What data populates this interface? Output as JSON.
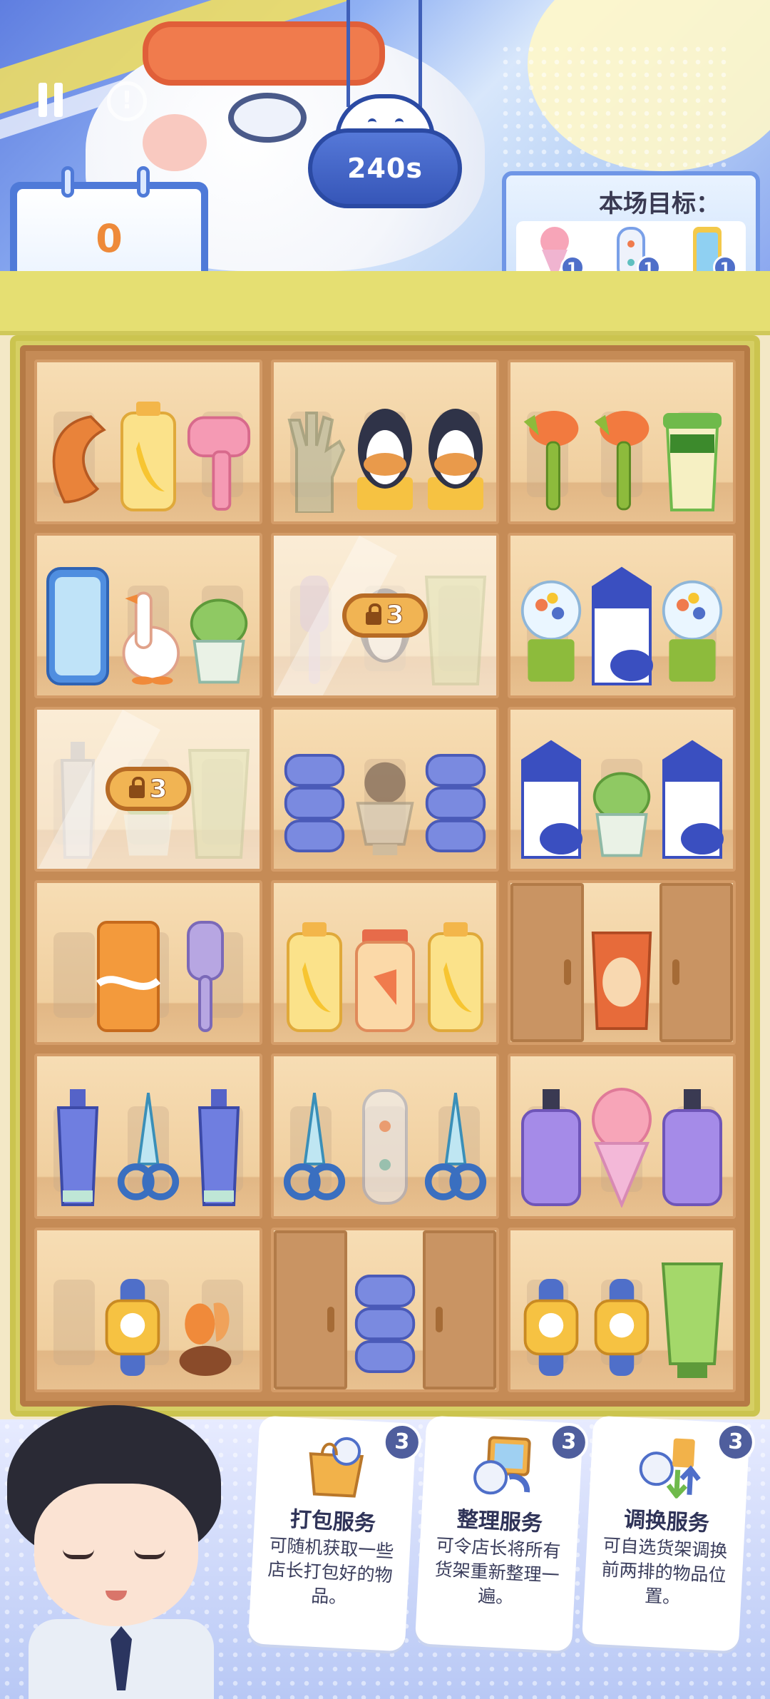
{
  "hud": {
    "score": "0",
    "timer": "240s",
    "goal_title": "本场目标：",
    "goals": [
      {
        "item": "ice-cream",
        "count": "1"
      },
      {
        "item": "game-controller",
        "count": "1"
      },
      {
        "item": "phone",
        "count": "1"
      }
    ]
  },
  "shelf": {
    "locks": [
      {
        "cell": "row2-col2",
        "count": "3"
      },
      {
        "cell": "row3-col1",
        "count": "3"
      }
    ]
  },
  "services": [
    {
      "title": "打包服务",
      "count": "3",
      "desc": "可随机获取一些店长打包好的物品。"
    },
    {
      "title": "整理服务",
      "count": "3",
      "desc": "可令店长将所有货架重新整理一遍。"
    },
    {
      "title": "调换服务",
      "count": "3",
      "desc": "可自选货架调换前两排的物品位置。"
    }
  ],
  "colors": {
    "shelf_wood": "#c58b56",
    "shelf_frame": "#d6cf64",
    "accent_blue": "#4f7ad8",
    "score_orange": "#ee8a3a",
    "lock_gold": "#f1b453"
  }
}
